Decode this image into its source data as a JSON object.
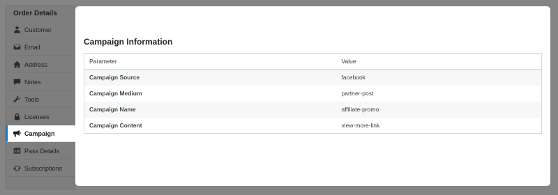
{
  "sidebar": {
    "title": "Order Details",
    "items": [
      {
        "label": "Customer",
        "icon": "user-icon"
      },
      {
        "label": "Email",
        "icon": "envelope-icon"
      },
      {
        "label": "Address",
        "icon": "home-icon"
      },
      {
        "label": "Notes",
        "icon": "comment-icon"
      },
      {
        "label": "Tools",
        "icon": "wrench-icon"
      },
      {
        "label": "Licenses",
        "icon": "lock-icon"
      },
      {
        "label": "Campaign",
        "icon": "megaphone-icon",
        "active": true
      },
      {
        "label": "Pass Details",
        "icon": "table-icon"
      },
      {
        "label": "Subscriptions",
        "icon": "refresh-icon"
      }
    ]
  },
  "main": {
    "section_title": "Campaign Information",
    "table": {
      "headers": [
        "Parameter",
        "Value"
      ],
      "rows": [
        {
          "param": "Campaign Source",
          "value": "facebook"
        },
        {
          "param": "Campaign Medium",
          "value": "partner-post"
        },
        {
          "param": "Campaign Name",
          "value": "affiliate-promo"
        },
        {
          "param": "Campaign Content",
          "value": "view-more-link"
        }
      ]
    }
  },
  "colors": {
    "accent": "#2271b1",
    "overlay": "#858585"
  }
}
